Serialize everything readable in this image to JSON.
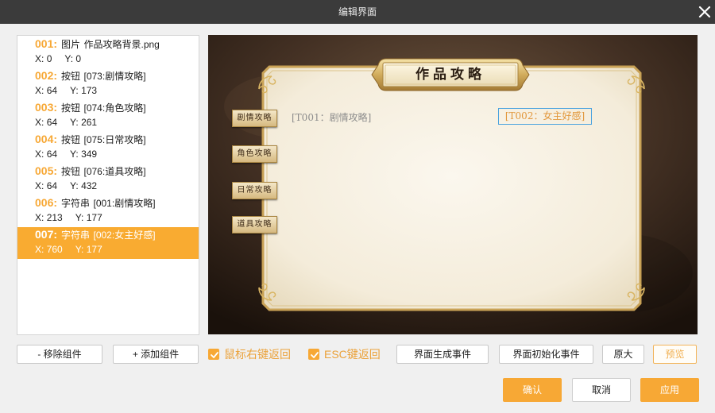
{
  "window": {
    "title": "编辑界面"
  },
  "list": {
    "x_label": "X:",
    "y_label": "Y:",
    "selected_index": 6,
    "items": [
      {
        "num": "001:",
        "type": "图片",
        "name": "作品攻略背景.png",
        "x_readout": "0",
        "y_readout": "0"
      },
      {
        "num": "002:",
        "type": "按钮",
        "name": "[073:剧情攻略]",
        "x_readout": "64",
        "y_readout": "173"
      },
      {
        "num": "003:",
        "type": "按钮",
        "name": "[074:角色攻略]",
        "x_readout": "64",
        "y_readout": "261"
      },
      {
        "num": "004:",
        "type": "按钮",
        "name": "[075:日常攻略]",
        "x_readout": "64",
        "y_readout": "349"
      },
      {
        "num": "005:",
        "type": "按钮",
        "name": "[076:道具攻略]",
        "x_readout": "64",
        "y_readout": "432"
      },
      {
        "num": "006:",
        "type": "字符串",
        "name": "[001:剧情攻略]",
        "x_readout": "213",
        "y_readout": "177"
      },
      {
        "num": "007:",
        "type": "字符串",
        "name": "[002:女主好感]",
        "x_readout": "760",
        "y_readout": "177"
      }
    ]
  },
  "preview": {
    "title": "作品攻略",
    "buttons": [
      "剧情攻略",
      "角色攻略",
      "日常攻略",
      "道具攻略"
    ],
    "strings": [
      "[T001：剧情攻略]",
      "[T002：女主好感]"
    ]
  },
  "toolbar": {
    "remove": "- 移除组件",
    "add": "+ 添加组件",
    "right_click_back": {
      "label": "鼠标右键返回",
      "checked": true
    },
    "esc_back": {
      "label": "ESC键返回",
      "checked": true
    },
    "gen_event": "界面生成事件",
    "init_event": "界面初始化事件",
    "original_size": "原大",
    "preview": "预览"
  },
  "footer": {
    "confirm": "确认",
    "cancel": "取消",
    "apply": "应用"
  },
  "colors": {
    "accent": "#f7a835",
    "selected_bg": "#f9ab31",
    "title_bar": "#3b3b3b",
    "selection_outline": "#4aa3df"
  }
}
